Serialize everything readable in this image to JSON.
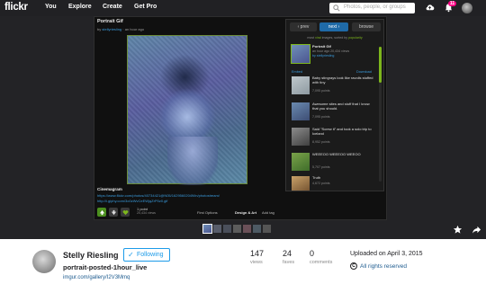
{
  "nav": {
    "logo": "flickr",
    "links": [
      "You",
      "Explore",
      "Create",
      "Get Pro"
    ],
    "search_placeholder": "Photos, people, or groups",
    "notification_count": "11"
  },
  "lightbox": {
    "title": "Portrait Gif",
    "subtitle_by": "by",
    "subtitle_user": "stellyriesling",
    "subtitle_time": "an hour ago",
    "caption_title": "Cinemagram",
    "caption_lines": [
      "https://www.flickr.com/photos/40734421@N05/16295602049/in/photostream/",
      "http://i.giphy.com/3o0zWvCeEWjqZrP0z0.gif"
    ],
    "points": "1 point",
    "views_small": "20,434 views",
    "first_options": "First Options",
    "design_art": "Design & Art",
    "add_tag": "Add tag"
  },
  "side": {
    "prev": "‹ prev",
    "next": "next ›",
    "browse": "browse",
    "caption_parts": [
      "most ",
      "viral",
      " images, sorted by ",
      "popularity"
    ],
    "embed": "Embed",
    "download": "Download",
    "items": [
      {
        "title": "Portrait Gif",
        "sub": "an hour ago  20,434 views",
        "extra": "by stellyriesling"
      },
      {
        "title": "Baby stingrays look like ravoils stuffed with tiny",
        "sub": "7,095 points",
        "extra": ""
      },
      {
        "title": "Awesome sites and stuff that I know that you should.",
        "sub": "7,095 points",
        "extra": ""
      },
      {
        "title": "Said \"Screw it\" and took a solo trip to Iceland",
        "sub": "8,952 points",
        "extra": ""
      },
      {
        "title": "WEEEOO WEEEOO WEEOO",
        "sub": "5,707 points",
        "extra": ""
      },
      {
        "title": "Truth",
        "sub": "4,672 points",
        "extra": ""
      }
    ]
  },
  "info": {
    "owner": "Stelly Riesling",
    "follow_label": "Following",
    "photo_title": "portrait-posted-1hour_live",
    "photo_link": "imgur.com/gallery/I2V3Mmq",
    "stats": [
      {
        "value": "147",
        "label": "views"
      },
      {
        "value": "24",
        "label": "faves"
      },
      {
        "value": "0",
        "label": "comments"
      }
    ],
    "uploaded": "Uploaded on April 3, 2015",
    "rights": "All rights reserved"
  }
}
